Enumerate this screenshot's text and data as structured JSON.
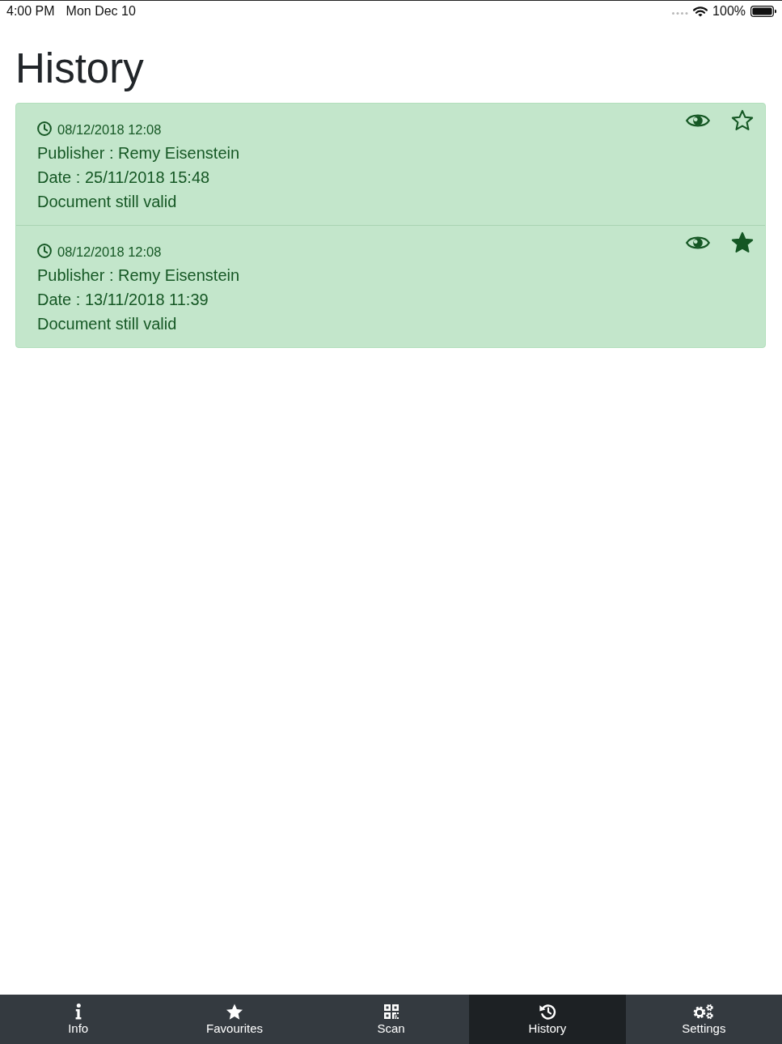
{
  "status_bar": {
    "time": "4:00 PM",
    "date": "Mon Dec 10",
    "battery": "100%"
  },
  "page": {
    "title": "History"
  },
  "history": [
    {
      "timestamp": "08/12/2018 12:08",
      "publisher": "Publisher : Remy Eisenstein",
      "date": "Date : 25/11/2018 15:48",
      "status": "Document still valid",
      "favourite": false
    },
    {
      "timestamp": "08/12/2018 12:08",
      "publisher": "Publisher : Remy Eisenstein",
      "date": "Date : 13/11/2018 11:39",
      "status": "Document still valid",
      "favourite": true
    }
  ],
  "tab_bar": [
    {
      "label": "Info",
      "kind": "info",
      "selected": false
    },
    {
      "label": "Favourites",
      "kind": "favourites",
      "selected": false
    },
    {
      "label": "Scan",
      "kind": "scan",
      "selected": false
    },
    {
      "label": "History",
      "kind": "history",
      "selected": true
    },
    {
      "label": "Settings",
      "kind": "settings",
      "selected": false
    }
  ]
}
